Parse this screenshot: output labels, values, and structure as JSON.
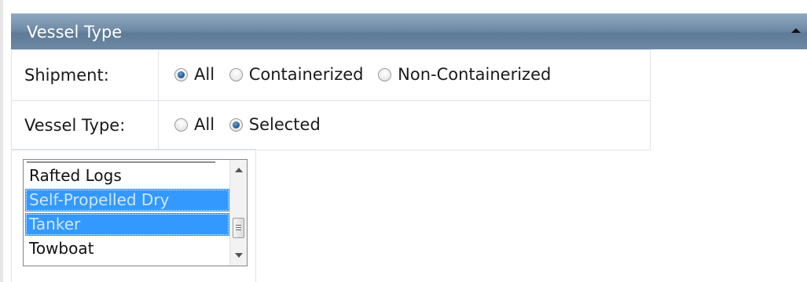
{
  "panel": {
    "title": "Vessel Type"
  },
  "filters": {
    "shipment": {
      "label": "Shipment:",
      "options": [
        "All",
        "Containerized",
        "Non-Containerized"
      ],
      "selected": "All"
    },
    "vessel_type": {
      "label": "Vessel Type:",
      "options": [
        "All",
        "Selected"
      ],
      "selected": "Selected"
    }
  },
  "vessel_list": {
    "items": [
      "Rafted Logs",
      "Self-Propelled Dry",
      "Tanker",
      "Towboat"
    ],
    "selected_items": [
      "Self-Propelled Dry",
      "Tanker"
    ]
  },
  "colors": {
    "header": "#6f8ba6",
    "selection": "#3399ff",
    "radio_checked": "#245d96"
  },
  "icons": {
    "collapse": "triangle-up-icon",
    "scroll_up": "scroll-up-arrow-icon",
    "scroll_down": "scroll-down-arrow-icon"
  }
}
